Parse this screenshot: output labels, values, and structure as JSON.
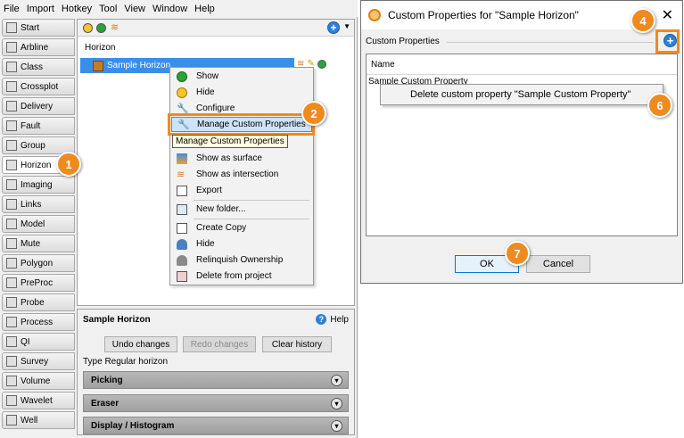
{
  "menubar": [
    "File",
    "Import",
    "Hotkey",
    "Tool",
    "View",
    "Window",
    "Help"
  ],
  "tabs": [
    "Start",
    "Arbline",
    "Class",
    "Crossplot",
    "Delivery",
    "Fault",
    "Group",
    "Horizon",
    "Imaging",
    "Links",
    "Model",
    "Mute",
    "Polygon",
    "PreProc",
    "Probe",
    "Process",
    "QI",
    "Survey",
    "Volume",
    "Wavelet",
    "Well"
  ],
  "tree": {
    "column_header": "Horizon",
    "selected_item": "Sample Horizon"
  },
  "context_menu": {
    "items": [
      "Show",
      "Hide",
      "Configure",
      "Manage Custom Properties",
      "Show as surface",
      "Show as intersection",
      "Export",
      "New folder...",
      "Create Copy",
      "Hide",
      "Relinquish Ownership",
      "Delete from project"
    ],
    "highlighted": "Manage Custom Properties",
    "tooltip": "Manage Custom Properties"
  },
  "bottom_panel": {
    "title": "Sample Horizon",
    "help": "Help",
    "buttons": {
      "undo": "Undo changes",
      "redo": "Redo changes",
      "clear": "Clear history"
    },
    "type_text": "Type Regular horizon",
    "sections": [
      "Picking",
      "Eraser",
      "Display / Histogram"
    ]
  },
  "dialog": {
    "title": "Custom Properties for \"Sample Horizon\"",
    "close": "✕",
    "group_label": "Custom Properties",
    "column": "Name",
    "row": "Sample Custom Property",
    "popup_item": "Delete custom property \"Sample Custom Property\"",
    "ok": "OK",
    "cancel": "Cancel"
  },
  "callouts": [
    "1",
    "2",
    "4",
    "6",
    "7"
  ],
  "colors": {
    "accent": "#ef8a1f",
    "selection": "#3b8ee8",
    "ok_border": "#0078d7"
  }
}
